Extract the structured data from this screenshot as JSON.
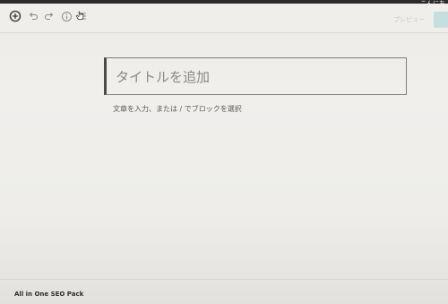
{
  "admin_bar": {
    "greeting": "こんにち"
  },
  "toolbar": {
    "icons": [
      "add-block-icon",
      "undo-icon",
      "redo-icon",
      "info-icon",
      "list-view-icon"
    ],
    "preview_label": "プレビュー"
  },
  "editor": {
    "title_placeholder": "タイトルを追加",
    "block_placeholder": "文章を入力、または / でブロックを選択"
  },
  "meta_boxes": {
    "seo_title": "All in One SEO Pack"
  },
  "colors": {
    "admin_bar": "#2b2b2b",
    "publish_accent": "#c5dede"
  }
}
